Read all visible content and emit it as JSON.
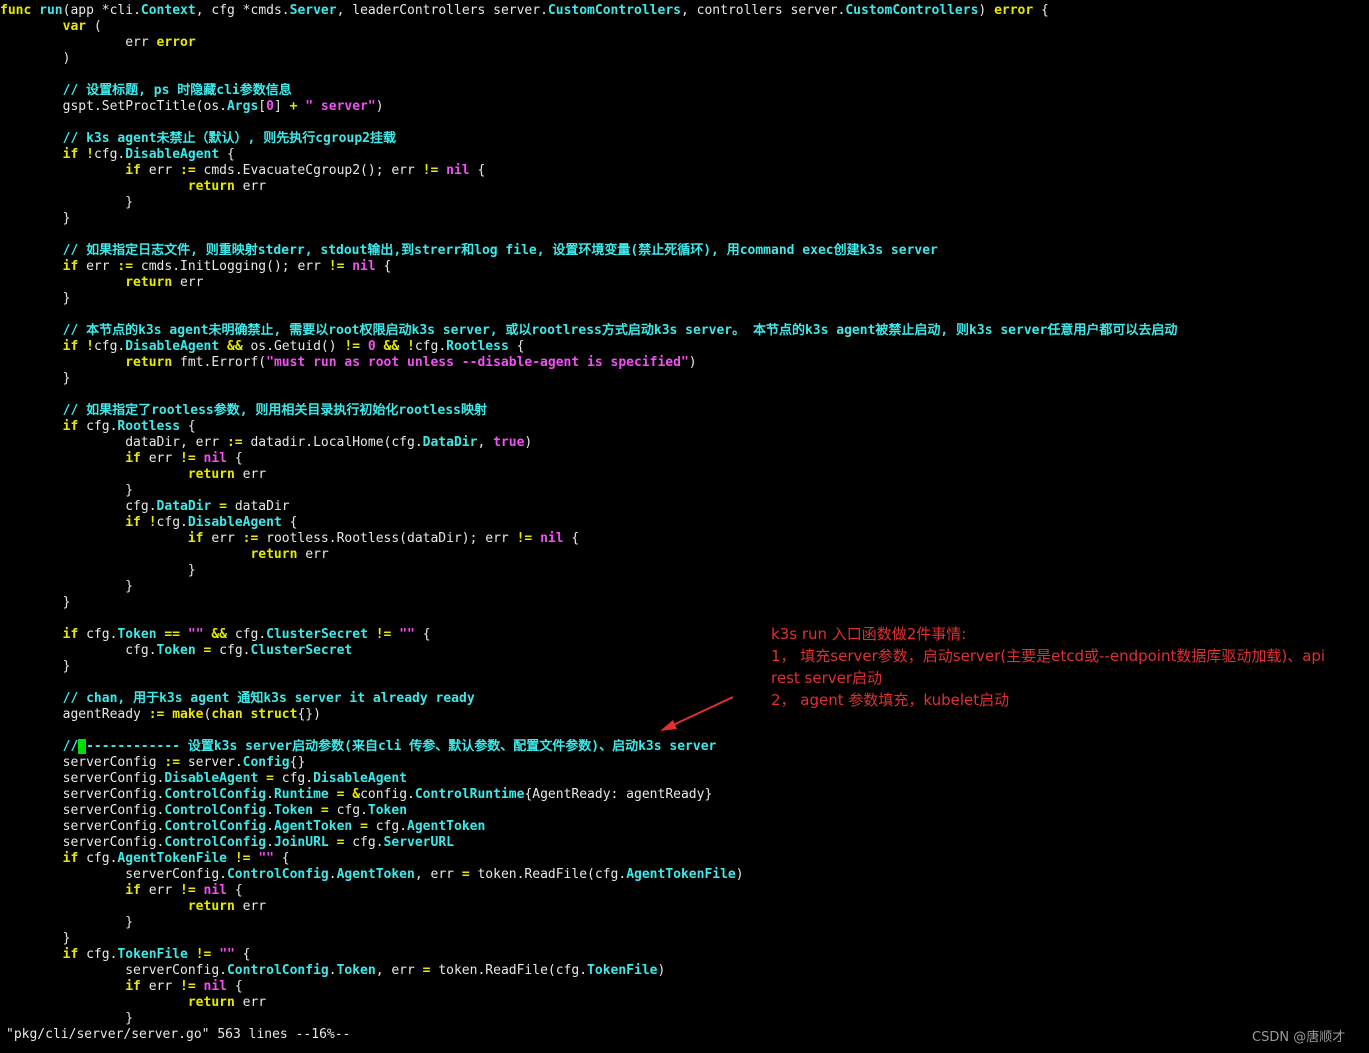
{
  "editor": {
    "lines": [
      [
        [
          "k",
          "func"
        ],
        [
          "p",
          " "
        ],
        [
          "f",
          "run"
        ],
        [
          "p",
          "(app *cli."
        ],
        [
          "fb",
          "Context"
        ],
        [
          "p",
          ", cfg *cmds."
        ],
        [
          "fb",
          "Server"
        ],
        [
          "p",
          ", leaderControllers server."
        ],
        [
          "fb",
          "CustomControllers"
        ],
        [
          "p",
          ", controllers server."
        ],
        [
          "fb",
          "CustomControllers"
        ],
        [
          "p",
          ") "
        ],
        [
          "k",
          "error"
        ],
        [
          "p",
          " {"
        ]
      ],
      [
        [
          "p",
          "        "
        ],
        [
          "k",
          "var"
        ],
        [
          "p",
          " ("
        ]
      ],
      [
        [
          "p",
          "                err "
        ],
        [
          "k",
          "error"
        ]
      ],
      [
        [
          "p",
          "        )"
        ]
      ],
      [
        [
          "p",
          ""
        ]
      ],
      [
        [
          "p",
          "        "
        ],
        [
          "c",
          "// 设置标题, ps 时隐藏cli参数信息"
        ]
      ],
      [
        [
          "p",
          "        gspt.SetProcTitle(os."
        ],
        [
          "fb",
          "Args"
        ],
        [
          "p",
          "["
        ],
        [
          "n",
          "0"
        ],
        [
          "p",
          "] "
        ],
        [
          "o",
          "+"
        ],
        [
          "p",
          " "
        ],
        [
          "s",
          "\" server\""
        ],
        [
          "p",
          ")"
        ]
      ],
      [
        [
          "p",
          ""
        ]
      ],
      [
        [
          "p",
          "        "
        ],
        [
          "c",
          "// k3s agent未禁止（默认）, 则先执行cgroup2挂载"
        ]
      ],
      [
        [
          "p",
          "        "
        ],
        [
          "k",
          "if"
        ],
        [
          "p",
          " "
        ],
        [
          "o",
          "!"
        ],
        [
          "p",
          "cfg."
        ],
        [
          "fb",
          "DisableAgent"
        ],
        [
          "p",
          " {"
        ]
      ],
      [
        [
          "p",
          "                "
        ],
        [
          "k",
          "if"
        ],
        [
          "p",
          " err "
        ],
        [
          "o",
          ":="
        ],
        [
          "p",
          " cmds.EvacuateCgroup2(); err "
        ],
        [
          "o",
          "!="
        ],
        [
          "p",
          " "
        ],
        [
          "n",
          "nil"
        ],
        [
          "p",
          " {"
        ]
      ],
      [
        [
          "p",
          "                        "
        ],
        [
          "k",
          "return"
        ],
        [
          "p",
          " err"
        ]
      ],
      [
        [
          "p",
          "                }"
        ]
      ],
      [
        [
          "p",
          "        }"
        ]
      ],
      [
        [
          "p",
          ""
        ]
      ],
      [
        [
          "p",
          "        "
        ],
        [
          "c",
          "// 如果指定日志文件, 则重映射stderr, stdout输出,到strerr和log file, 设置环境变量(禁止死循环), 用command exec创建k3s server"
        ]
      ],
      [
        [
          "p",
          "        "
        ],
        [
          "k",
          "if"
        ],
        [
          "p",
          " err "
        ],
        [
          "o",
          ":="
        ],
        [
          "p",
          " cmds.InitLogging(); err "
        ],
        [
          "o",
          "!="
        ],
        [
          "p",
          " "
        ],
        [
          "n",
          "nil"
        ],
        [
          "p",
          " {"
        ]
      ],
      [
        [
          "p",
          "                "
        ],
        [
          "k",
          "return"
        ],
        [
          "p",
          " err"
        ]
      ],
      [
        [
          "p",
          "        }"
        ]
      ],
      [
        [
          "p",
          ""
        ]
      ],
      [
        [
          "p",
          "        "
        ],
        [
          "c",
          "// 本节点的k3s agent未明确禁止, 需要以root权限启动k3s server, 或以rootlress方式启动k3s server。 本节点的k3s agent被禁止启动, 则k3s server任意用户都可以去启动"
        ]
      ],
      [
        [
          "p",
          "        "
        ],
        [
          "k",
          "if"
        ],
        [
          "p",
          " "
        ],
        [
          "o",
          "!"
        ],
        [
          "p",
          "cfg."
        ],
        [
          "fb",
          "DisableAgent"
        ],
        [
          "p",
          " "
        ],
        [
          "o",
          "&&"
        ],
        [
          "p",
          " os.Getuid() "
        ],
        [
          "o",
          "!="
        ],
        [
          "p",
          " "
        ],
        [
          "n",
          "0"
        ],
        [
          "p",
          " "
        ],
        [
          "o",
          "&&"
        ],
        [
          "p",
          " "
        ],
        [
          "o",
          "!"
        ],
        [
          "p",
          "cfg."
        ],
        [
          "fb",
          "Rootless"
        ],
        [
          "p",
          " {"
        ]
      ],
      [
        [
          "p",
          "                "
        ],
        [
          "k",
          "return"
        ],
        [
          "p",
          " fmt.Errorf("
        ],
        [
          "s",
          "\"must run as root unless --disable-agent is specified\""
        ],
        [
          "p",
          ")"
        ]
      ],
      [
        [
          "p",
          "        }"
        ]
      ],
      [
        [
          "p",
          ""
        ]
      ],
      [
        [
          "p",
          "        "
        ],
        [
          "c",
          "// 如果指定了rootless参数, 则用相关目录执行初始化rootless映射"
        ]
      ],
      [
        [
          "p",
          "        "
        ],
        [
          "k",
          "if"
        ],
        [
          "p",
          " cfg."
        ],
        [
          "fb",
          "Rootless"
        ],
        [
          "p",
          " {"
        ]
      ],
      [
        [
          "p",
          "                dataDir, err "
        ],
        [
          "o",
          ":="
        ],
        [
          "p",
          " datadir.LocalHome(cfg."
        ],
        [
          "fb",
          "DataDir"
        ],
        [
          "p",
          ", "
        ],
        [
          "n",
          "true"
        ],
        [
          "p",
          ")"
        ]
      ],
      [
        [
          "p",
          "                "
        ],
        [
          "k",
          "if"
        ],
        [
          "p",
          " err "
        ],
        [
          "o",
          "!="
        ],
        [
          "p",
          " "
        ],
        [
          "n",
          "nil"
        ],
        [
          "p",
          " {"
        ]
      ],
      [
        [
          "p",
          "                        "
        ],
        [
          "k",
          "return"
        ],
        [
          "p",
          " err"
        ]
      ],
      [
        [
          "p",
          "                }"
        ]
      ],
      [
        [
          "p",
          "                cfg."
        ],
        [
          "fb",
          "DataDir"
        ],
        [
          "p",
          " "
        ],
        [
          "o",
          "="
        ],
        [
          "p",
          " dataDir"
        ]
      ],
      [
        [
          "p",
          "                "
        ],
        [
          "k",
          "if"
        ],
        [
          "p",
          " "
        ],
        [
          "o",
          "!"
        ],
        [
          "p",
          "cfg."
        ],
        [
          "fb",
          "DisableAgent"
        ],
        [
          "p",
          " {"
        ]
      ],
      [
        [
          "p",
          "                        "
        ],
        [
          "k",
          "if"
        ],
        [
          "p",
          " err "
        ],
        [
          "o",
          ":="
        ],
        [
          "p",
          " rootless.Rootless(dataDir); err "
        ],
        [
          "o",
          "!="
        ],
        [
          "p",
          " "
        ],
        [
          "n",
          "nil"
        ],
        [
          "p",
          " {"
        ]
      ],
      [
        [
          "p",
          "                                "
        ],
        [
          "k",
          "return"
        ],
        [
          "p",
          " err"
        ]
      ],
      [
        [
          "p",
          "                        }"
        ]
      ],
      [
        [
          "p",
          "                }"
        ]
      ],
      [
        [
          "p",
          "        }"
        ]
      ],
      [
        [
          "p",
          ""
        ]
      ],
      [
        [
          "p",
          "        "
        ],
        [
          "k",
          "if"
        ],
        [
          "p",
          " cfg."
        ],
        [
          "fb",
          "Token"
        ],
        [
          "p",
          " "
        ],
        [
          "o",
          "=="
        ],
        [
          "p",
          " "
        ],
        [
          "s",
          "\"\""
        ],
        [
          "p",
          " "
        ],
        [
          "o",
          "&&"
        ],
        [
          "p",
          " cfg."
        ],
        [
          "fb",
          "ClusterSecret"
        ],
        [
          "p",
          " "
        ],
        [
          "o",
          "!="
        ],
        [
          "p",
          " "
        ],
        [
          "s",
          "\"\""
        ],
        [
          "p",
          " {"
        ]
      ],
      [
        [
          "p",
          "                cfg."
        ],
        [
          "fb",
          "Token"
        ],
        [
          "p",
          " "
        ],
        [
          "o",
          "="
        ],
        [
          "p",
          " cfg."
        ],
        [
          "fb",
          "ClusterSecret"
        ]
      ],
      [
        [
          "p",
          "        }"
        ]
      ],
      [
        [
          "p",
          ""
        ]
      ],
      [
        [
          "p",
          "        "
        ],
        [
          "c",
          "// chan, 用于k3s agent 通知k3s server it already ready"
        ]
      ],
      [
        [
          "p",
          "        agentReady "
        ],
        [
          "o",
          ":="
        ],
        [
          "p",
          " "
        ],
        [
          "k",
          "make"
        ],
        [
          "p",
          "("
        ],
        [
          "k",
          "chan"
        ],
        [
          "p",
          " "
        ],
        [
          "k",
          "struct"
        ],
        [
          "p",
          "{})"
        ]
      ],
      [
        [
          "p",
          ""
        ]
      ],
      [
        [
          "p",
          "        "
        ],
        [
          "c",
          "//"
        ],
        [
          "cur",
          "-"
        ],
        [
          "c",
          "------------ 设置k3s server启动参数(来自cli 传参、默认参数、配置文件参数)、启动k3s server"
        ]
      ],
      [
        [
          "p",
          "        serverConfig "
        ],
        [
          "o",
          ":="
        ],
        [
          "p",
          " server."
        ],
        [
          "fb",
          "Config"
        ],
        [
          "p",
          "{}"
        ]
      ],
      [
        [
          "p",
          "        serverConfig."
        ],
        [
          "fb",
          "DisableAgent"
        ],
        [
          "p",
          " "
        ],
        [
          "o",
          "="
        ],
        [
          "p",
          " cfg."
        ],
        [
          "fb",
          "DisableAgent"
        ]
      ],
      [
        [
          "p",
          "        serverConfig."
        ],
        [
          "fb",
          "ControlConfig"
        ],
        [
          "p",
          "."
        ],
        [
          "fb",
          "Runtime"
        ],
        [
          "p",
          " "
        ],
        [
          "o",
          "="
        ],
        [
          "p",
          " "
        ],
        [
          "o",
          "&"
        ],
        [
          "p",
          "config."
        ],
        [
          "fb",
          "ControlRuntime"
        ],
        [
          "p",
          "{AgentReady: agentReady}"
        ]
      ],
      [
        [
          "p",
          "        serverConfig."
        ],
        [
          "fb",
          "ControlConfig"
        ],
        [
          "p",
          "."
        ],
        [
          "fb",
          "Token"
        ],
        [
          "p",
          " "
        ],
        [
          "o",
          "="
        ],
        [
          "p",
          " cfg."
        ],
        [
          "fb",
          "Token"
        ]
      ],
      [
        [
          "p",
          "        serverConfig."
        ],
        [
          "fb",
          "ControlConfig"
        ],
        [
          "p",
          "."
        ],
        [
          "fb",
          "AgentToken"
        ],
        [
          "p",
          " "
        ],
        [
          "o",
          "="
        ],
        [
          "p",
          " cfg."
        ],
        [
          "fb",
          "AgentToken"
        ]
      ],
      [
        [
          "p",
          "        serverConfig."
        ],
        [
          "fb",
          "ControlConfig"
        ],
        [
          "p",
          "."
        ],
        [
          "fb",
          "JoinURL"
        ],
        [
          "p",
          " "
        ],
        [
          "o",
          "="
        ],
        [
          "p",
          " cfg."
        ],
        [
          "fb",
          "ServerURL"
        ]
      ],
      [
        [
          "p",
          "        "
        ],
        [
          "k",
          "if"
        ],
        [
          "p",
          " cfg."
        ],
        [
          "fb",
          "AgentTokenFile"
        ],
        [
          "p",
          " "
        ],
        [
          "o",
          "!="
        ],
        [
          "p",
          " "
        ],
        [
          "s",
          "\"\""
        ],
        [
          "p",
          " {"
        ]
      ],
      [
        [
          "p",
          "                serverConfig."
        ],
        [
          "fb",
          "ControlConfig"
        ],
        [
          "p",
          "."
        ],
        [
          "fb",
          "AgentToken"
        ],
        [
          "p",
          ", err "
        ],
        [
          "o",
          "="
        ],
        [
          "p",
          " token.ReadFile(cfg."
        ],
        [
          "fb",
          "AgentTokenFile"
        ],
        [
          "p",
          ")"
        ]
      ],
      [
        [
          "p",
          "                "
        ],
        [
          "k",
          "if"
        ],
        [
          "p",
          " err "
        ],
        [
          "o",
          "!="
        ],
        [
          "p",
          " "
        ],
        [
          "n",
          "nil"
        ],
        [
          "p",
          " {"
        ]
      ],
      [
        [
          "p",
          "                        "
        ],
        [
          "k",
          "return"
        ],
        [
          "p",
          " err"
        ]
      ],
      [
        [
          "p",
          "                }"
        ]
      ],
      [
        [
          "p",
          "        }"
        ]
      ],
      [
        [
          "p",
          "        "
        ],
        [
          "k",
          "if"
        ],
        [
          "p",
          " cfg."
        ],
        [
          "fb",
          "TokenFile"
        ],
        [
          "p",
          " "
        ],
        [
          "o",
          "!="
        ],
        [
          "p",
          " "
        ],
        [
          "s",
          "\"\""
        ],
        [
          "p",
          " {"
        ]
      ],
      [
        [
          "p",
          "                serverConfig."
        ],
        [
          "fb",
          "ControlConfig"
        ],
        [
          "p",
          "."
        ],
        [
          "fb",
          "Token"
        ],
        [
          "p",
          ", err "
        ],
        [
          "o",
          "="
        ],
        [
          "p",
          " token.ReadFile(cfg."
        ],
        [
          "fb",
          "TokenFile"
        ],
        [
          "p",
          ")"
        ]
      ],
      [
        [
          "p",
          "                "
        ],
        [
          "k",
          "if"
        ],
        [
          "p",
          " err "
        ],
        [
          "o",
          "!="
        ],
        [
          "p",
          " "
        ],
        [
          "n",
          "nil"
        ],
        [
          "p",
          " {"
        ]
      ],
      [
        [
          "p",
          "                        "
        ],
        [
          "k",
          "return"
        ],
        [
          "p",
          " err"
        ]
      ],
      [
        [
          "p",
          "                }"
        ]
      ]
    ],
    "status_line": "\"pkg/cli/server/server.go\" 563 lines --16%--"
  },
  "annotation": {
    "color": "#e03030",
    "lines": [
      "k3s run 入口函数做2件事情:",
      "1， 填充server参数，启动server(主要是etcd或--endpoint数据库驱动加载)、api rest server启动",
      "2， agent 参数填充，kubelet启动"
    ]
  },
  "watermark": "CSDN @唐顺才"
}
